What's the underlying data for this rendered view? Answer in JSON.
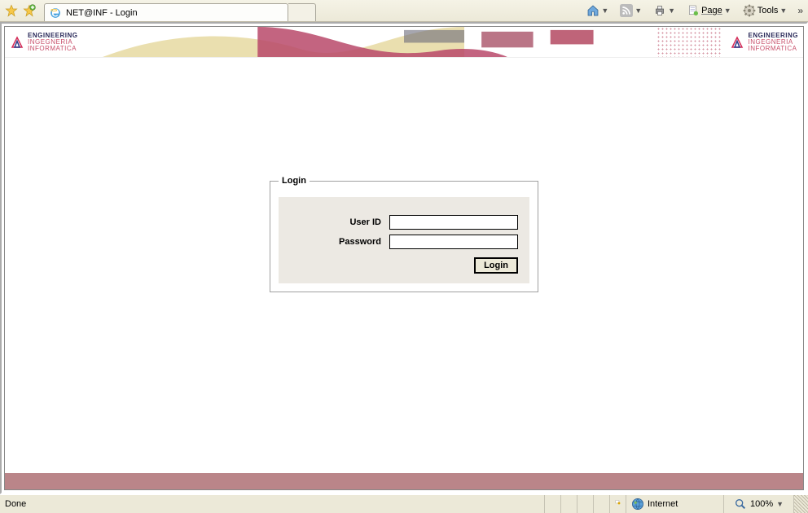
{
  "browser": {
    "tab_title": "NET@INF - Login",
    "tools": {
      "page": "Page",
      "tools": "Tools"
    }
  },
  "brand": {
    "line1": "ENGINEERING",
    "line2": "INGEGNERIA",
    "line3": "INFORMATICA"
  },
  "login": {
    "legend": "Login",
    "user_id_label": "User ID",
    "password_label": "Password",
    "submit": "Login"
  },
  "statusbar": {
    "done": "Done",
    "zone": "Internet",
    "zoom": "100%"
  }
}
